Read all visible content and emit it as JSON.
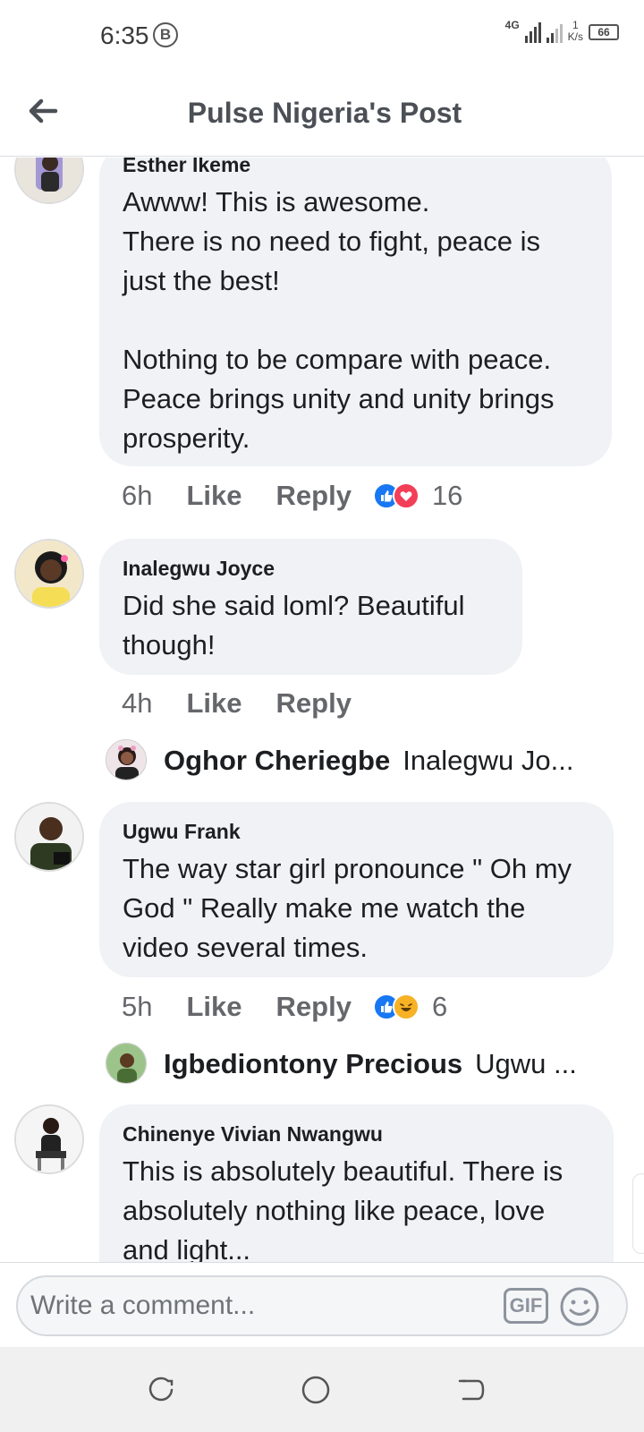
{
  "status_bar": {
    "time": "6:35",
    "time_badge": "B",
    "network": "4G",
    "speed_value": "1",
    "speed_unit": "K/s",
    "battery": "66"
  },
  "header": {
    "title": "Pulse Nigeria's Post",
    "back_icon": "arrow-left-icon"
  },
  "comments": [
    {
      "author": "Esther Ikeme",
      "text": "Awww!  This is awesome.\nThere is no need to fight, peace is just the best!\n\nNothing to be compare with peace. Peace brings unity and unity brings prosperity.",
      "time": "6h",
      "like_label": "Like",
      "reply_label": "Reply",
      "reactions": [
        "like-icon",
        "love-icon"
      ],
      "reaction_count": "16"
    },
    {
      "author": "Inalegwu Joyce",
      "text": "Did  she  said loml? Beautiful though!",
      "time": "4h",
      "like_label": "Like",
      "reply_label": "Reply",
      "reply_preview": {
        "author": "Oghor Cheriegbe",
        "snippet": "Inalegwu Jo..."
      }
    },
    {
      "author": "Ugwu Frank",
      "text": "The way star girl pronounce \" Oh my God \" Really make me watch the video several times.",
      "time": "5h",
      "like_label": "Like",
      "reply_label": "Reply",
      "reactions": [
        "like-icon",
        "haha-icon"
      ],
      "reaction_count": "6",
      "reply_preview": {
        "author": "Igbediontony Precious",
        "snippet": "Ugwu ..."
      }
    },
    {
      "author": "Chinenye Vivian Nwangwu",
      "text": "This is absolutely beautiful. There is absolutely nothing like peace, love and light..."
    }
  ],
  "composer": {
    "placeholder": "Write a comment...",
    "gif_label": "GIF",
    "emoji_icon": "smiley-icon"
  },
  "nav": {
    "recents_icon": "recents-icon",
    "home_icon": "home-circle-icon",
    "back_icon": "back-icon"
  },
  "colors": {
    "bubble_bg": "#f0f2f5",
    "secondary_text": "#65676b",
    "like_blue": "#1877f2",
    "love_red": "#f33e58",
    "haha_yellow": "#f7b125"
  }
}
